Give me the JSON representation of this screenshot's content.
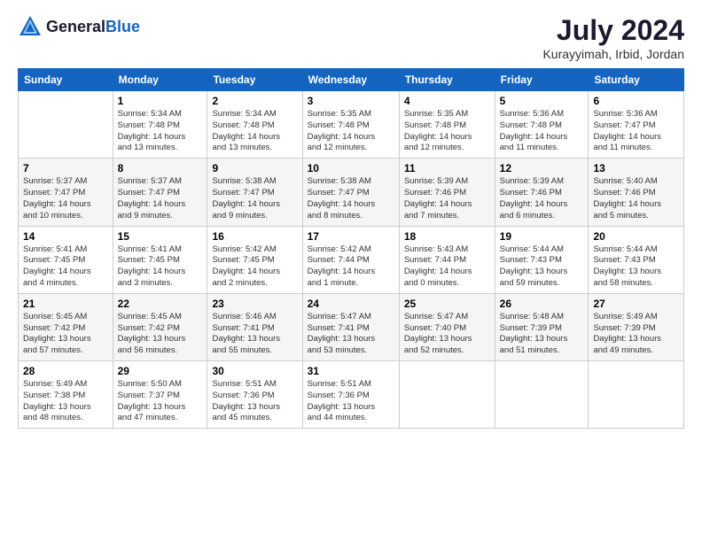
{
  "header": {
    "logo_general": "General",
    "logo_blue": "Blue",
    "title": "July 2024",
    "location": "Kurayyimah, Irbid, Jordan"
  },
  "columns": [
    "Sunday",
    "Monday",
    "Tuesday",
    "Wednesday",
    "Thursday",
    "Friday",
    "Saturday"
  ],
  "weeks": [
    [
      {
        "day": "",
        "info": ""
      },
      {
        "day": "1",
        "info": "Sunrise: 5:34 AM\nSunset: 7:48 PM\nDaylight: 14 hours\nand 13 minutes."
      },
      {
        "day": "2",
        "info": "Sunrise: 5:34 AM\nSunset: 7:48 PM\nDaylight: 14 hours\nand 13 minutes."
      },
      {
        "day": "3",
        "info": "Sunrise: 5:35 AM\nSunset: 7:48 PM\nDaylight: 14 hours\nand 12 minutes."
      },
      {
        "day": "4",
        "info": "Sunrise: 5:35 AM\nSunset: 7:48 PM\nDaylight: 14 hours\nand 12 minutes."
      },
      {
        "day": "5",
        "info": "Sunrise: 5:36 AM\nSunset: 7:48 PM\nDaylight: 14 hours\nand 11 minutes."
      },
      {
        "day": "6",
        "info": "Sunrise: 5:36 AM\nSunset: 7:47 PM\nDaylight: 14 hours\nand 11 minutes."
      }
    ],
    [
      {
        "day": "7",
        "info": "Sunrise: 5:37 AM\nSunset: 7:47 PM\nDaylight: 14 hours\nand 10 minutes."
      },
      {
        "day": "8",
        "info": "Sunrise: 5:37 AM\nSunset: 7:47 PM\nDaylight: 14 hours\nand 9 minutes."
      },
      {
        "day": "9",
        "info": "Sunrise: 5:38 AM\nSunset: 7:47 PM\nDaylight: 14 hours\nand 9 minutes."
      },
      {
        "day": "10",
        "info": "Sunrise: 5:38 AM\nSunset: 7:47 PM\nDaylight: 14 hours\nand 8 minutes."
      },
      {
        "day": "11",
        "info": "Sunrise: 5:39 AM\nSunset: 7:46 PM\nDaylight: 14 hours\nand 7 minutes."
      },
      {
        "day": "12",
        "info": "Sunrise: 5:39 AM\nSunset: 7:46 PM\nDaylight: 14 hours\nand 6 minutes."
      },
      {
        "day": "13",
        "info": "Sunrise: 5:40 AM\nSunset: 7:46 PM\nDaylight: 14 hours\nand 5 minutes."
      }
    ],
    [
      {
        "day": "14",
        "info": "Sunrise: 5:41 AM\nSunset: 7:45 PM\nDaylight: 14 hours\nand 4 minutes."
      },
      {
        "day": "15",
        "info": "Sunrise: 5:41 AM\nSunset: 7:45 PM\nDaylight: 14 hours\nand 3 minutes."
      },
      {
        "day": "16",
        "info": "Sunrise: 5:42 AM\nSunset: 7:45 PM\nDaylight: 14 hours\nand 2 minutes."
      },
      {
        "day": "17",
        "info": "Sunrise: 5:42 AM\nSunset: 7:44 PM\nDaylight: 14 hours\nand 1 minute."
      },
      {
        "day": "18",
        "info": "Sunrise: 5:43 AM\nSunset: 7:44 PM\nDaylight: 14 hours\nand 0 minutes."
      },
      {
        "day": "19",
        "info": "Sunrise: 5:44 AM\nSunset: 7:43 PM\nDaylight: 13 hours\nand 59 minutes."
      },
      {
        "day": "20",
        "info": "Sunrise: 5:44 AM\nSunset: 7:43 PM\nDaylight: 13 hours\nand 58 minutes."
      }
    ],
    [
      {
        "day": "21",
        "info": "Sunrise: 5:45 AM\nSunset: 7:42 PM\nDaylight: 13 hours\nand 57 minutes."
      },
      {
        "day": "22",
        "info": "Sunrise: 5:45 AM\nSunset: 7:42 PM\nDaylight: 13 hours\nand 56 minutes."
      },
      {
        "day": "23",
        "info": "Sunrise: 5:46 AM\nSunset: 7:41 PM\nDaylight: 13 hours\nand 55 minutes."
      },
      {
        "day": "24",
        "info": "Sunrise: 5:47 AM\nSunset: 7:41 PM\nDaylight: 13 hours\nand 53 minutes."
      },
      {
        "day": "25",
        "info": "Sunrise: 5:47 AM\nSunset: 7:40 PM\nDaylight: 13 hours\nand 52 minutes."
      },
      {
        "day": "26",
        "info": "Sunrise: 5:48 AM\nSunset: 7:39 PM\nDaylight: 13 hours\nand 51 minutes."
      },
      {
        "day": "27",
        "info": "Sunrise: 5:49 AM\nSunset: 7:39 PM\nDaylight: 13 hours\nand 49 minutes."
      }
    ],
    [
      {
        "day": "28",
        "info": "Sunrise: 5:49 AM\nSunset: 7:38 PM\nDaylight: 13 hours\nand 48 minutes."
      },
      {
        "day": "29",
        "info": "Sunrise: 5:50 AM\nSunset: 7:37 PM\nDaylight: 13 hours\nand 47 minutes."
      },
      {
        "day": "30",
        "info": "Sunrise: 5:51 AM\nSunset: 7:36 PM\nDaylight: 13 hours\nand 45 minutes."
      },
      {
        "day": "31",
        "info": "Sunrise: 5:51 AM\nSunset: 7:36 PM\nDaylight: 13 hours\nand 44 minutes."
      },
      {
        "day": "",
        "info": ""
      },
      {
        "day": "",
        "info": ""
      },
      {
        "day": "",
        "info": ""
      }
    ]
  ]
}
